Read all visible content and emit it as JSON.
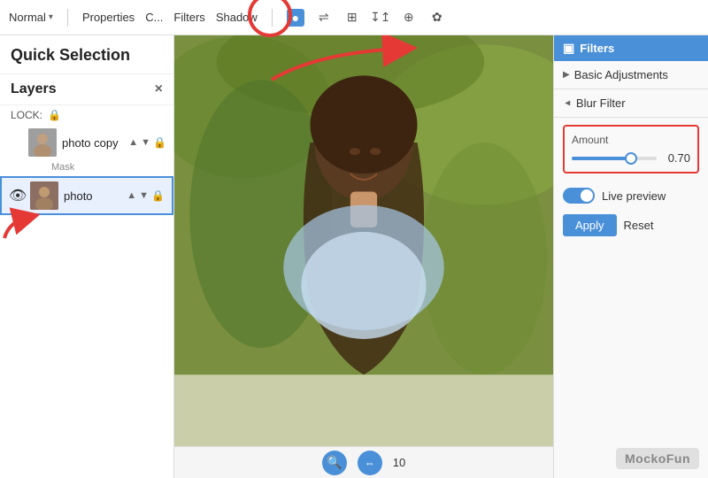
{
  "app": {
    "title": "Quick Selection"
  },
  "toolbar": {
    "blend_mode": "Normal",
    "blend_arrow": "▾",
    "properties_label": "Properties",
    "channels_label": "C...",
    "filters_label": "Filters",
    "shadow_label": "Shadow",
    "icons": [
      "●",
      "⇌",
      "⊞",
      "↧↥",
      "⊕↑",
      "✿"
    ]
  },
  "sidebar": {
    "title": "Quick Selection",
    "layers_label": "Layers",
    "close_label": "×",
    "lock_label": "LOCK:",
    "lock_icon": "🔒",
    "layers": [
      {
        "name": "photo copy",
        "has_mask": true,
        "mask_label": "Mask",
        "visible": false,
        "selected": false
      },
      {
        "name": "photo",
        "has_mask": false,
        "visible": true,
        "selected": true
      }
    ]
  },
  "filters_panel": {
    "header": "Filters",
    "basic_adjustments": "Basic Adjustments",
    "blur_filter": "Blur Filter",
    "amount_label": "Amount",
    "amount_value": "0.70",
    "slider_percent": 70,
    "live_preview_label": "Live preview",
    "apply_label": "Apply",
    "reset_label": "Reset"
  },
  "canvas": {
    "zoom_value": "10"
  },
  "branding": {
    "label": "MockoFun"
  }
}
